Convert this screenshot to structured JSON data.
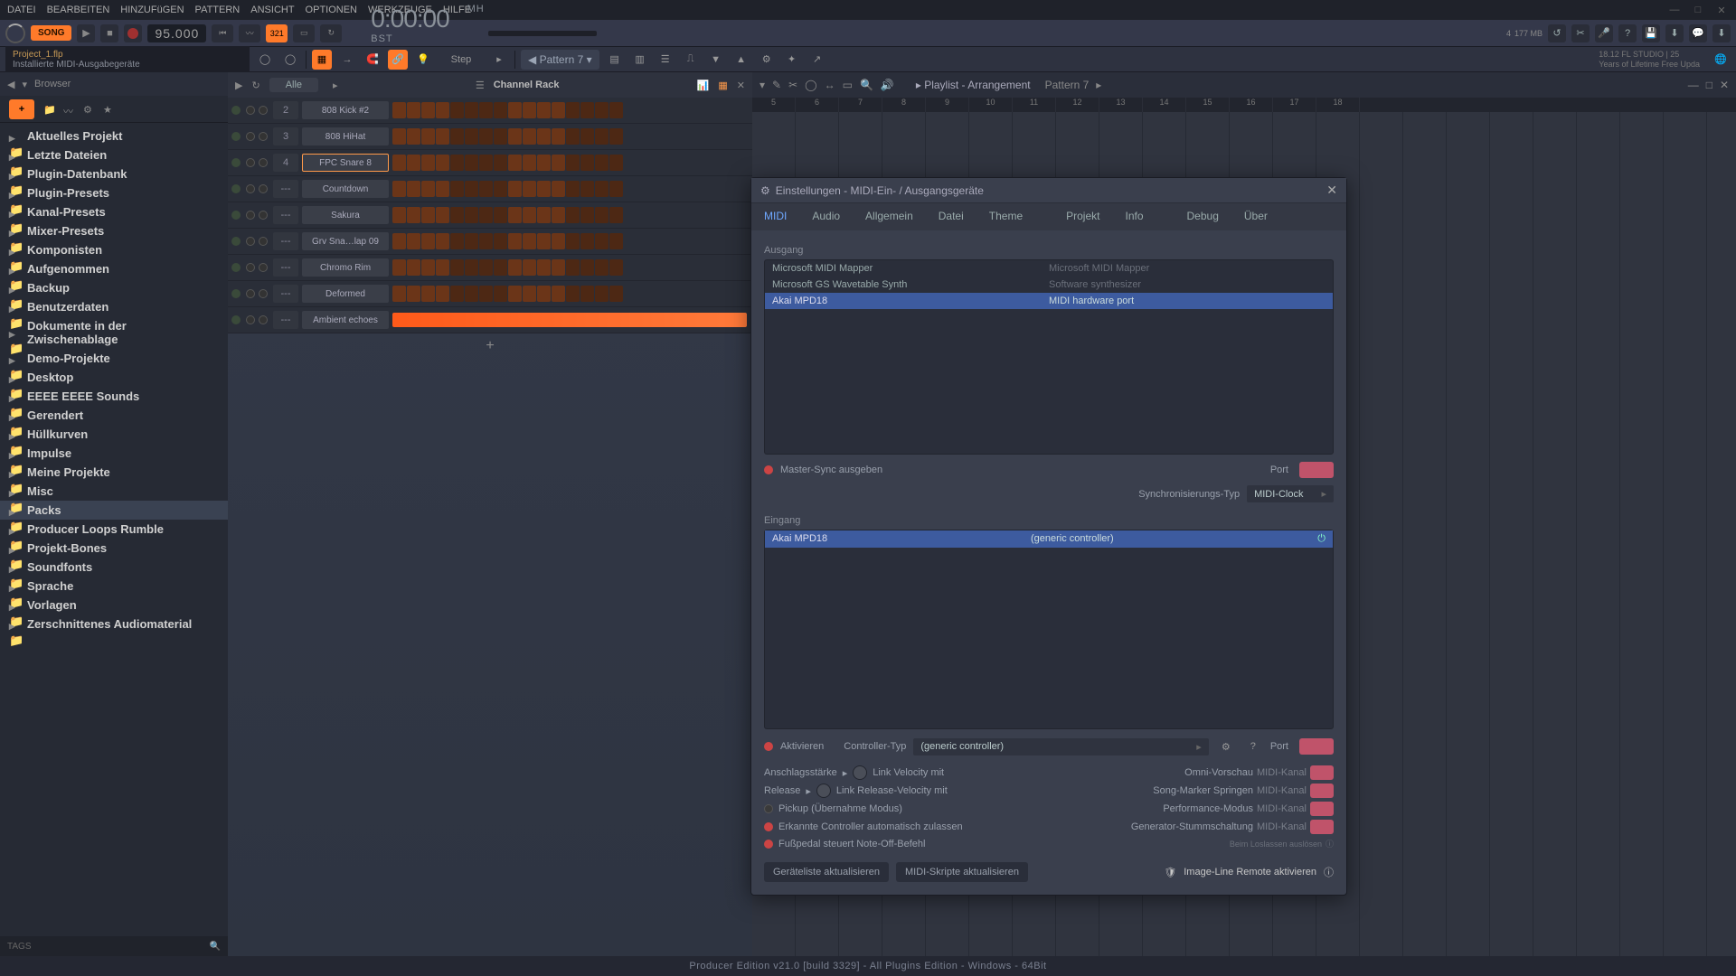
{
  "menu": [
    "DATEI",
    "BEARBEITEN",
    "HINZUFüGEN",
    "PATTERN",
    "ANSICHT",
    "OPTIONEN",
    "WERKZEUGE",
    "HILFE"
  ],
  "transport": {
    "song": "SONG",
    "tempo": "95.000",
    "grid": "321",
    "time": "0:00",
    "timeSub": ":00",
    "timeLabels": [
      "M",
      "B",
      "S",
      "T"
    ]
  },
  "stats": {
    "v1": "4",
    "v2": "177 MB",
    "v3": ""
  },
  "hint": {
    "t1": "Project_1.flp",
    "t2": "Installierte MIDI-Ausgabegeräte"
  },
  "modeLabel": "Step",
  "patternSel": "Pattern 7",
  "version": {
    "l1": "18.12   FL STUDIO | 25",
    "l2": "Years of Lifetime Free Upda"
  },
  "browser": {
    "title": "Browser",
    "items": [
      "Aktuelles Projekt",
      "Letzte Dateien",
      "Plugin-Datenbank",
      "Plugin-Presets",
      "Kanal-Presets",
      "Mixer-Presets",
      "Komponisten",
      "Aufgenommen",
      "Backup",
      "Benutzerdaten",
      "Dokumente in der Zwischenablage",
      "Demo-Projekte",
      "Desktop",
      "EEEE EEEE Sounds",
      "Gerendert",
      "Hüllkurven",
      "Impulse",
      "Meine Projekte",
      "Misc",
      "Packs",
      "Producer Loops Rumble",
      "Projekt-Bones",
      "Soundfonts",
      "Sprache",
      "Vorlagen",
      "Zerschnittenes Audiomaterial"
    ],
    "selectedIndex": 19,
    "tags": "TAGS"
  },
  "channelRack": {
    "title": "Channel Rack",
    "filter": "Alle",
    "channels": [
      {
        "num": "2",
        "name": "808 Kick #2"
      },
      {
        "num": "3",
        "name": "808 HiHat"
      },
      {
        "num": "4",
        "name": "FPC Snare 8",
        "selected": true
      },
      {
        "num": "---",
        "name": "Countdown"
      },
      {
        "num": "---",
        "name": "Sakura"
      },
      {
        "num": "---",
        "name": "Grv Sna…lap 09"
      },
      {
        "num": "---",
        "name": "Chromo Rim"
      },
      {
        "num": "---",
        "name": "Deformed"
      },
      {
        "num": "---",
        "name": "Ambient echoes",
        "audio": true
      }
    ],
    "add": "+"
  },
  "playlist": {
    "title": "Playlist - Arrangement",
    "pattern": "Pattern 7",
    "ruler": [
      "5",
      "6",
      "7",
      "8",
      "9",
      "10",
      "11",
      "12",
      "13",
      "14",
      "15",
      "16",
      "17",
      "18"
    ]
  },
  "dialog": {
    "title": "Einstellungen - MIDI-Ein- / Ausgangsgeräte",
    "tabs": [
      "MIDI",
      "Audio",
      "Allgemein",
      "Datei",
      "Theme",
      "Projekt",
      "Info",
      "Debug",
      "Über"
    ],
    "activeTab": 0,
    "outputLabel": "Ausgang",
    "outputs": [
      {
        "name": "Microsoft MIDI Mapper",
        "desc": "Microsoft MIDI Mapper"
      },
      {
        "name": "Microsoft GS Wavetable Synth",
        "desc": "Software synthesizer"
      },
      {
        "name": "Akai MPD18",
        "desc": "MIDI hardware port",
        "selected": true
      }
    ],
    "masterSync": "Master-Sync ausgeben",
    "port": "Port",
    "syncType": "Synchronisierungs-Typ",
    "syncValue": "MIDI-Clock",
    "inputLabel": "Eingang",
    "inputs": [
      {
        "name": "Akai MPD18",
        "desc": "(generic controller)",
        "selected": true,
        "enabled": true
      }
    ],
    "activate": "Aktivieren",
    "ctrlType": "Controller-Typ",
    "ctrlValue": "(generic controller)",
    "velocityLabel": "Anschlagsstärke",
    "linkVel": "Link Velocity mit",
    "releaseLabel": "Release",
    "linkRel": "Link Release-Velocity mit",
    "omni": "Omni-Vorschau",
    "midiCh": "MIDI-Kanal",
    "songMarker": "Song-Marker Springen",
    "perfMode": "Performance-Modus",
    "genMute": "Generator-Stummschaltung",
    "pickup": "Pickup (Übernahme Modus)",
    "autoAccept": "Erkannte Controller automatisch zulassen",
    "footPedal": "Fußpedal steuert Note-Off-Befehl",
    "releaseTrigger": "Beim Loslassen auslösen",
    "refreshDev": "Geräteliste aktualisieren",
    "refreshScripts": "MIDI-Skripte aktualisieren",
    "ilRemote": "Image-Line Remote aktivieren"
  },
  "footer": "Producer Edition v21.0 [build 3329] - All Plugins Edition - Windows - 64Bit"
}
